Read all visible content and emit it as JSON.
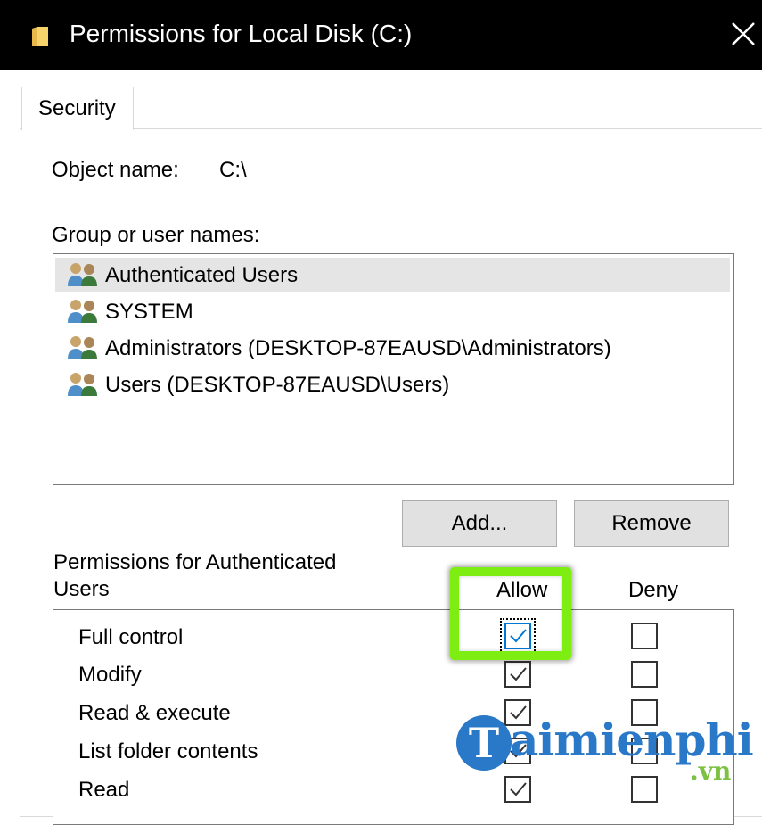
{
  "window": {
    "title": "Permissions for Local Disk (C:)",
    "close_icon": "close-icon"
  },
  "tabs": [
    {
      "label": "Security"
    }
  ],
  "object": {
    "label": "Object name:",
    "value": "C:\\"
  },
  "groups": {
    "label": "Group or user names:",
    "items": [
      {
        "name": "Authenticated Users",
        "selected": true
      },
      {
        "name": "SYSTEM",
        "selected": false
      },
      {
        "name": "Administrators (DESKTOP-87EAUSD\\Administrators)",
        "selected": false
      },
      {
        "name": "Users (DESKTOP-87EAUSD\\Users)",
        "selected": false
      }
    ]
  },
  "buttons": {
    "add": "Add...",
    "remove": "Remove"
  },
  "permissions": {
    "label_line1": "Permissions for Authenticated",
    "label_line2": "Users",
    "allow_header": "Allow",
    "deny_header": "Deny",
    "items": [
      {
        "name": "Full control",
        "allow": true,
        "deny": false
      },
      {
        "name": "Modify",
        "allow": true,
        "deny": false
      },
      {
        "name": "Read & execute",
        "allow": true,
        "deny": false
      },
      {
        "name": "List folder contents",
        "allow": true,
        "deny": false
      },
      {
        "name": "Read",
        "allow": true,
        "deny": false
      }
    ]
  },
  "watermark": {
    "letter": "T",
    "text": "aimienphi",
    "suffix": ".vn"
  },
  "colors": {
    "highlight": "#7ded12",
    "checkbox_focus": "#0078d7",
    "watermark_blue": "#2a78c8",
    "watermark_green": "#7cc142"
  }
}
